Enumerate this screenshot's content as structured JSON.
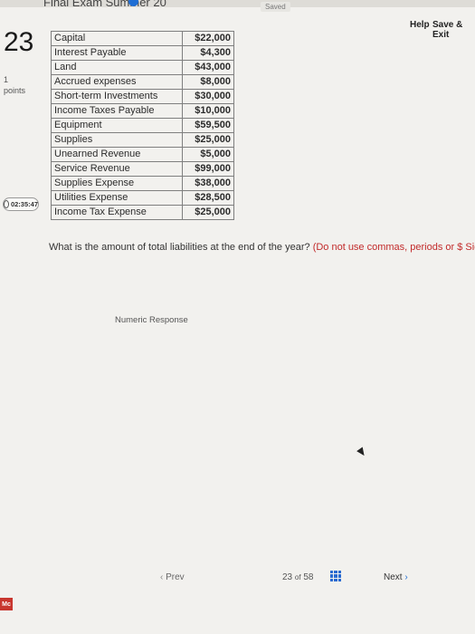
{
  "header": {
    "exam_title": "Final Exam Summer 20",
    "status": "Saved",
    "help_label": "Help",
    "save_exit_label": "Save & Exit"
  },
  "question": {
    "number": "23",
    "points": "1",
    "points_label": "points",
    "timer": "02:35:47",
    "table": [
      {
        "label": "Capital",
        "amount": "$22,000"
      },
      {
        "label": "Interest Payable",
        "amount": "$4,300"
      },
      {
        "label": "Land",
        "amount": "$43,000"
      },
      {
        "label": "Accrued expenses",
        "amount": "$8,000"
      },
      {
        "label": "Short-term Investments",
        "amount": "$30,000"
      },
      {
        "label": "Income Taxes Payable",
        "amount": "$10,000"
      },
      {
        "label": "Equipment",
        "amount": "$59,500"
      },
      {
        "label": "Supplies",
        "amount": "$25,000"
      },
      {
        "label": "Unearned Revenue",
        "amount": "$5,000"
      },
      {
        "label": "Service Revenue",
        "amount": "$99,000"
      },
      {
        "label": "Supplies Expense",
        "amount": "$38,000"
      },
      {
        "label": "Utilities Expense",
        "amount": "$28,500"
      },
      {
        "label": "Income Tax Expense",
        "amount": "$25,000"
      }
    ],
    "prompt": "What is the amount of total liabilities at the end of the year?",
    "prompt_note": "(Do not use commas, periods or $ Signs)",
    "response_label": "Numeric Response",
    "response_value": ""
  },
  "footer": {
    "prev_label": "Prev",
    "current_page": "23",
    "of_label": "of",
    "total_pages": "58",
    "next_label": "Next",
    "logo_text": "Mc"
  },
  "icons": {
    "info": "info-icon",
    "timer": "clock-icon",
    "grid": "grid-icon",
    "prev": "chevron-left-icon",
    "next": "chevron-right-icon"
  },
  "colors": {
    "accent": "#1f6ed4",
    "warning_text": "#c22a2a",
    "logo": "#c8362e"
  }
}
